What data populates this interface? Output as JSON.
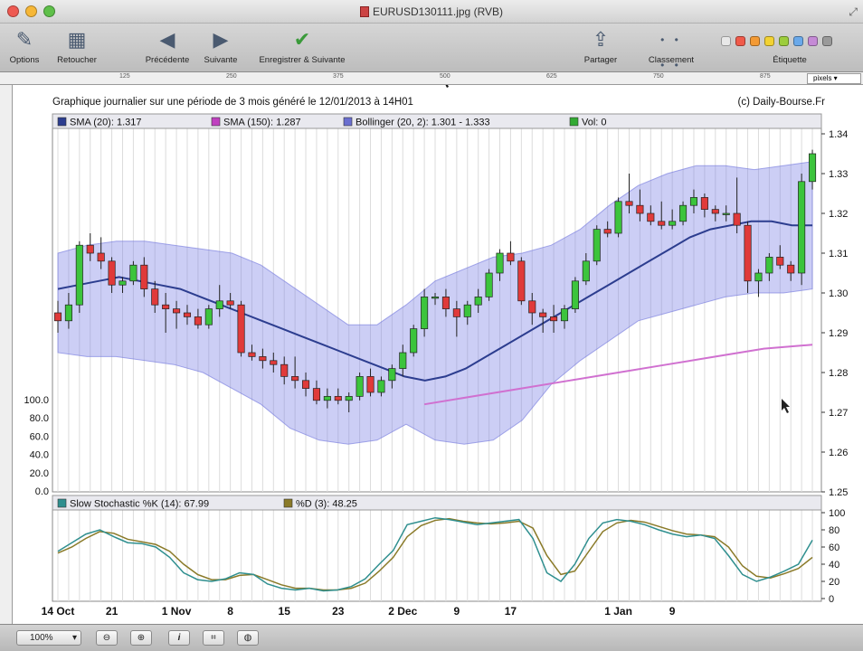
{
  "window": {
    "title": "EURUSD130111.jpg (RVB)",
    "lights": [
      "#ee5a52",
      "#f6b737",
      "#5fc04a"
    ]
  },
  "toolbar": {
    "options": "Options",
    "retoucher": "Retoucher",
    "precedente": "Précédente",
    "suivante": "Suivante",
    "enregistrer": "Enregistrer & Suivante",
    "partager": "Partager",
    "classement": "Classement",
    "etiquette": "Étiquette",
    "label_colors": [
      "#e8e8e8",
      "#f05a4a",
      "#f39a34",
      "#f2d233",
      "#9ccd3c",
      "#6aa9ea",
      "#c58ad6",
      "#9a9a9a"
    ]
  },
  "ruler": {
    "marks": [
      "125",
      "250",
      "375",
      "500",
      "625",
      "750",
      "875"
    ],
    "unit": "pixels"
  },
  "statusbar": {
    "zoom": "100%"
  },
  "chart_data": {
    "type": "candlestick",
    "title": "Graphique journalier sur une période de 3 mois généré le 12/01/2013 à 14H01",
    "source": "(c) Daily-Bourse.Fr",
    "legend": [
      {
        "label": "SMA (20): 1.317",
        "color": "#2c3d8f"
      },
      {
        "label": "SMA (150): 1.287",
        "color": "#c040c0"
      },
      {
        "label": "Bollinger (20, 2): 1.301 - 1.333",
        "color": "#6a6fd0"
      },
      {
        "label": "Vol: 0",
        "color": "#33aa33"
      }
    ],
    "x_ticks": [
      "14 Oct",
      "21",
      "1 Nov",
      "8",
      "15",
      "23",
      "2 Dec",
      "9",
      "17",
      "1 Jan",
      "9"
    ],
    "x_tick_index": [
      0,
      5,
      11,
      16,
      21,
      26,
      32,
      37,
      42,
      52,
      57
    ],
    "ylim": [
      1.25,
      1.345
    ],
    "y_ticks": [
      "1.34",
      "1.33",
      "1.32",
      "1.31",
      "1.30",
      "1.29",
      "1.28",
      "1.27",
      "1.26",
      "1.25"
    ],
    "y_tick_values": [
      1.34,
      1.33,
      1.32,
      1.31,
      1.3,
      1.29,
      1.28,
      1.27,
      1.26,
      1.25
    ],
    "vol_ticks": [
      "100.0",
      "80.0",
      "60.0",
      "40.0",
      "20.0",
      "0.0"
    ],
    "ohlc": [
      [
        1.295,
        1.298,
        1.29,
        1.293
      ],
      [
        1.293,
        1.3,
        1.291,
        1.297
      ],
      [
        1.297,
        1.313,
        1.295,
        1.312
      ],
      [
        1.312,
        1.315,
        1.308,
        1.31
      ],
      [
        1.31,
        1.314,
        1.306,
        1.308
      ],
      [
        1.308,
        1.309,
        1.3,
        1.302
      ],
      [
        1.302,
        1.304,
        1.3,
        1.303
      ],
      [
        1.303,
        1.308,
        1.302,
        1.307
      ],
      [
        1.307,
        1.309,
        1.299,
        1.301
      ],
      [
        1.301,
        1.303,
        1.295,
        1.297
      ],
      [
        1.297,
        1.3,
        1.29,
        1.296
      ],
      [
        1.296,
        1.298,
        1.291,
        1.295
      ],
      [
        1.295,
        1.297,
        1.292,
        1.294
      ],
      [
        1.294,
        1.296,
        1.291,
        1.292
      ],
      [
        1.292,
        1.297,
        1.291,
        1.296
      ],
      [
        1.296,
        1.302,
        1.294,
        1.298
      ],
      [
        1.298,
        1.3,
        1.296,
        1.297
      ],
      [
        1.297,
        1.298,
        1.284,
        1.285
      ],
      [
        1.285,
        1.287,
        1.283,
        1.284
      ],
      [
        1.284,
        1.286,
        1.281,
        1.283
      ],
      [
        1.283,
        1.285,
        1.28,
        1.282
      ],
      [
        1.282,
        1.284,
        1.277,
        1.279
      ],
      [
        1.279,
        1.284,
        1.276,
        1.278
      ],
      [
        1.278,
        1.28,
        1.274,
        1.276
      ],
      [
        1.276,
        1.278,
        1.272,
        1.273
      ],
      [
        1.273,
        1.276,
        1.271,
        1.274
      ],
      [
        1.274,
        1.276,
        1.272,
        1.273
      ],
      [
        1.273,
        1.275,
        1.27,
        1.274
      ],
      [
        1.274,
        1.28,
        1.273,
        1.279
      ],
      [
        1.279,
        1.281,
        1.274,
        1.275
      ],
      [
        1.275,
        1.279,
        1.274,
        1.278
      ],
      [
        1.278,
        1.282,
        1.276,
        1.281
      ],
      [
        1.281,
        1.287,
        1.279,
        1.285
      ],
      [
        1.285,
        1.292,
        1.284,
        1.291
      ],
      [
        1.291,
        1.301,
        1.289,
        1.299
      ],
      [
        1.299,
        1.3,
        1.297,
        1.299
      ],
      [
        1.299,
        1.301,
        1.294,
        1.296
      ],
      [
        1.296,
        1.298,
        1.289,
        1.294
      ],
      [
        1.294,
        1.298,
        1.292,
        1.297
      ],
      [
        1.297,
        1.301,
        1.295,
        1.299
      ],
      [
        1.299,
        1.306,
        1.298,
        1.305
      ],
      [
        1.305,
        1.311,
        1.303,
        1.31
      ],
      [
        1.31,
        1.313,
        1.307,
        1.308
      ],
      [
        1.308,
        1.309,
        1.297,
        1.298
      ],
      [
        1.298,
        1.3,
        1.292,
        1.295
      ],
      [
        1.295,
        1.296,
        1.29,
        1.294
      ],
      [
        1.294,
        1.297,
        1.29,
        1.293
      ],
      [
        1.293,
        1.297,
        1.291,
        1.296
      ],
      [
        1.296,
        1.304,
        1.295,
        1.303
      ],
      [
        1.303,
        1.31,
        1.302,
        1.308
      ],
      [
        1.308,
        1.317,
        1.307,
        1.316
      ],
      [
        1.316,
        1.318,
        1.314,
        1.315
      ],
      [
        1.315,
        1.324,
        1.314,
        1.323
      ],
      [
        1.323,
        1.33,
        1.32,
        1.322
      ],
      [
        1.322,
        1.326,
        1.318,
        1.32
      ],
      [
        1.32,
        1.322,
        1.317,
        1.318
      ],
      [
        1.318,
        1.323,
        1.316,
        1.317
      ],
      [
        1.317,
        1.321,
        1.316,
        1.318
      ],
      [
        1.318,
        1.323,
        1.317,
        1.322
      ],
      [
        1.322,
        1.326,
        1.32,
        1.324
      ],
      [
        1.324,
        1.325,
        1.319,
        1.321
      ],
      [
        1.321,
        1.322,
        1.318,
        1.32
      ],
      [
        1.32,
        1.322,
        1.318,
        1.32
      ],
      [
        1.32,
        1.329,
        1.315,
        1.317
      ],
      [
        1.317,
        1.318,
        1.3,
        1.303
      ],
      [
        1.303,
        1.306,
        1.299,
        1.305
      ],
      [
        1.305,
        1.31,
        1.303,
        1.309
      ],
      [
        1.309,
        1.312,
        1.306,
        1.307
      ],
      [
        1.307,
        1.308,
        1.303,
        1.305
      ],
      [
        1.305,
        1.33,
        1.302,
        1.328
      ],
      [
        1.328,
        1.336,
        1.326,
        1.335
      ]
    ],
    "sma20": [
      1.301,
      1.302,
      1.303,
      1.304,
      1.303,
      1.302,
      1.301,
      1.299,
      1.297,
      1.295,
      1.293,
      1.291,
      1.289,
      1.287,
      1.285,
      1.283,
      1.281,
      1.279,
      1.278,
      1.279,
      1.281,
      1.284,
      1.287,
      1.29,
      1.293,
      1.296,
      1.299,
      1.302,
      1.305,
      1.308,
      1.311,
      1.314,
      1.316,
      1.317,
      1.318,
      1.318,
      1.317,
      1.317
    ],
    "sma150": [
      1.272,
      1.274,
      1.276,
      1.278,
      1.28,
      1.282,
      1.284,
      1.286,
      1.287
    ],
    "bb_upper": [
      1.31,
      1.312,
      1.313,
      1.313,
      1.312,
      1.311,
      1.31,
      1.307,
      1.302,
      1.297,
      1.292,
      1.292,
      1.297,
      1.303,
      1.306,
      1.309,
      1.31,
      1.312,
      1.316,
      1.322,
      1.327,
      1.33,
      1.332,
      1.332,
      1.331,
      1.332,
      1.333
    ],
    "bb_lower": [
      1.285,
      1.284,
      1.284,
      1.283,
      1.282,
      1.28,
      1.276,
      1.272,
      1.266,
      1.263,
      1.262,
      1.263,
      1.267,
      1.263,
      1.262,
      1.263,
      1.268,
      1.277,
      1.283,
      1.288,
      1.293,
      1.295,
      1.297,
      1.299,
      1.3,
      1.3,
      1.301
    ],
    "stochastic": {
      "title": "Slow Stochastic %K (14): 67.99",
      "d_label": "%D (3): 48.25",
      "y_ticks": [
        "100",
        "80",
        "60",
        "40",
        "20",
        "0"
      ],
      "k_color": "#2f8f8f",
      "d_color": "#8a7a28",
      "k": [
        55,
        65,
        75,
        80,
        72,
        65,
        64,
        60,
        48,
        30,
        22,
        20,
        23,
        30,
        28,
        17,
        12,
        10,
        12,
        9,
        10,
        14,
        23,
        40,
        56,
        86,
        90,
        94,
        92,
        89,
        86,
        88,
        90,
        92,
        70,
        30,
        20,
        40,
        70,
        88,
        92,
        90,
        86,
        80,
        75,
        72,
        74,
        70,
        50,
        28,
        20,
        25,
        32,
        40,
        68
      ],
      "d": [
        53,
        60,
        70,
        78,
        76,
        69,
        66,
        63,
        55,
        40,
        28,
        22,
        22,
        27,
        28,
        22,
        16,
        12,
        12,
        10,
        10,
        12,
        18,
        32,
        48,
        72,
        85,
        91,
        93,
        90,
        88,
        87,
        88,
        90,
        82,
        50,
        28,
        32,
        55,
        78,
        88,
        91,
        89,
        84,
        79,
        75,
        74,
        72,
        60,
        38,
        26,
        24,
        29,
        35,
        48
      ]
    }
  }
}
